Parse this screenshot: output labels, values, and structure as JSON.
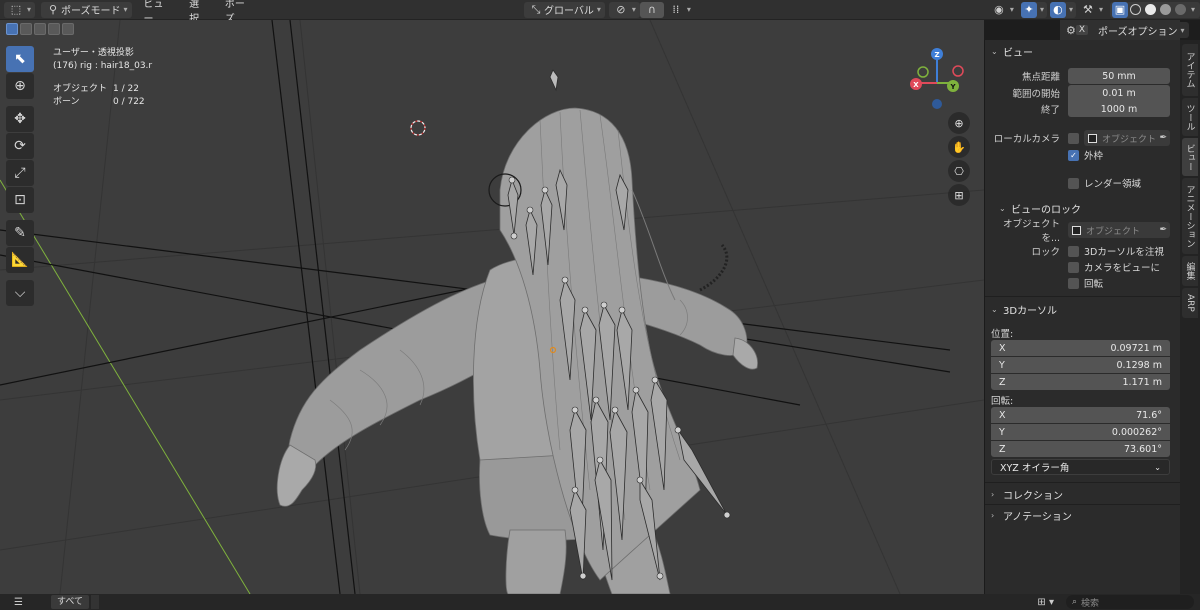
{
  "header": {
    "mode_label": "ポーズモード",
    "menus": [
      "ビュー",
      "選択",
      "ポーズ"
    ],
    "transform_orientation": "グローバル"
  },
  "overlay": {
    "view_name": "ユーザー・透視投影",
    "active_info": "(176) rig : hair18_03.r",
    "objects_label": "オブジェクト",
    "objects_value": "1 / 22",
    "bones_label": "ボーン",
    "bones_value": "0 / 722"
  },
  "gizmo": {
    "z": "Z",
    "y": "Y",
    "x": "X"
  },
  "npanel": {
    "header_dropdown": "ポーズオプション",
    "header_close": "X",
    "view_section": {
      "title": "ビュー",
      "focal_label": "焦点距離",
      "focal_value": "50 mm",
      "clip_start_label": "範囲の開始",
      "clip_start_value": "0.01 m",
      "clip_end_label": "終了",
      "clip_end_value": "1000 m",
      "local_camera_label": "ローカルカメラ",
      "local_camera_placeholder": "オブジェクト",
      "passepartout_label": "外枠",
      "render_region_label": "レンダー領域"
    },
    "lock_section": {
      "title": "ビューのロック",
      "lock_object_label": "オブジェクトを...",
      "lock_object_placeholder": "オブジェクト",
      "lock_label": "ロック",
      "lock_cursor": "3Dカーソルを注視",
      "lock_camera": "カメラをビューに",
      "lock_rotation": "回転"
    },
    "cursor_section": {
      "title": "3Dカーソル",
      "location_label": "位置:",
      "loc_x_label": "X",
      "loc_x": "0.09721 m",
      "loc_y_label": "Y",
      "loc_y": "0.1298 m",
      "loc_z_label": "Z",
      "loc_z": "1.171 m",
      "rotation_label": "回転:",
      "rot_x_label": "X",
      "rot_x": "71.6°",
      "rot_y_label": "Y",
      "rot_y": "0.000262°",
      "rot_z_label": "Z",
      "rot_z": "73.601°",
      "rotation_mode": "XYZ オイラー角"
    },
    "collection_title": "コレクション",
    "annotation_title": "アノテーション"
  },
  "tabs": [
    "アイテム",
    "ツール",
    "ビュー",
    "アニメーション",
    "編集",
    "ARP"
  ],
  "status": {
    "menu_icon": "hamburger-icon",
    "all_label": "すべて",
    "search_placeholder": "検索"
  },
  "colors": {
    "accent": "#4772b3",
    "viewport_bg": "#3d3d3d",
    "panel_bg": "#2b2b2b",
    "axis_x": "#e04a5a",
    "axis_y": "#7fb23d",
    "axis_z": "#3f7fd8"
  }
}
